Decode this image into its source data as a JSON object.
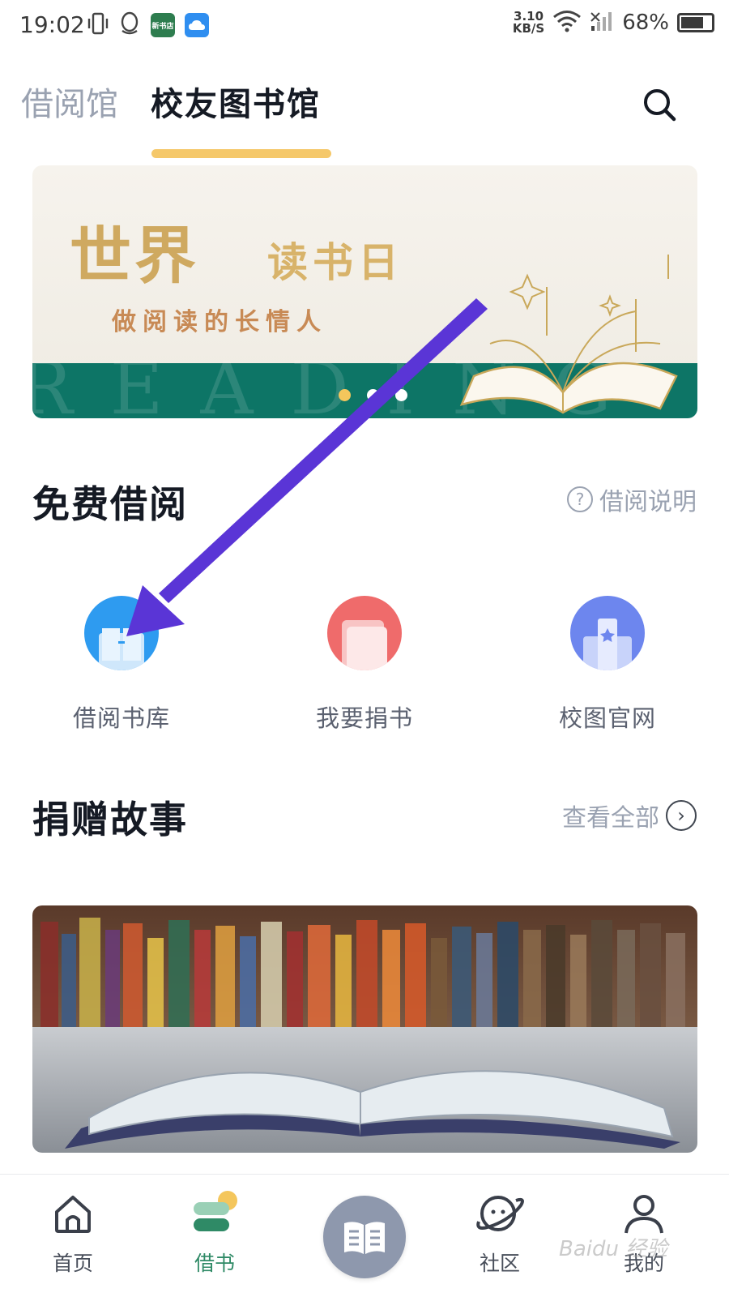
{
  "status_bar": {
    "time": "19:02",
    "net_speed_value": "3.10",
    "net_speed_unit": "KB/S",
    "battery": "68%",
    "app_icons": [
      "vibrate-icon",
      "qq-icon",
      "bookstore-app-icon",
      "cloud-icon"
    ],
    "bookstore_icon_text": "新书店"
  },
  "tabs": {
    "inactive": "借阅馆",
    "active": "校友图书馆"
  },
  "banner": {
    "title_big": "世界",
    "title_small": "读书日",
    "subtitle": "做阅读的长情人",
    "bg_word": "READING",
    "slide_count": 3,
    "active_slide": 1
  },
  "free_borrow": {
    "title": "免费借阅",
    "help_label": "借阅说明",
    "actions": [
      {
        "label": "借阅书库",
        "icon": "book-library-icon",
        "color": "#2e9bf0"
      },
      {
        "label": "我要捐书",
        "icon": "donate-book-icon",
        "color": "#ef6b6b"
      },
      {
        "label": "校图官网",
        "icon": "school-website-icon",
        "color": "#6d86ee"
      }
    ]
  },
  "donation_stories": {
    "title": "捐赠故事",
    "view_all": "查看全部"
  },
  "bottom_nav": {
    "items": [
      {
        "label": "首页",
        "icon": "home-icon"
      },
      {
        "label": "借书",
        "icon": "borrow-book-icon"
      },
      {
        "label": "",
        "icon": "open-book-icon"
      },
      {
        "label": "社区",
        "icon": "community-planet-icon"
      },
      {
        "label": "我的",
        "icon": "profile-icon"
      }
    ]
  },
  "watermark": "Baidu 经验",
  "colors": {
    "accent": "#f5c86a",
    "banner_band": "#0d7566",
    "nav_active": "#2f8a66",
    "annotation_arrow": "#5a35d6"
  }
}
